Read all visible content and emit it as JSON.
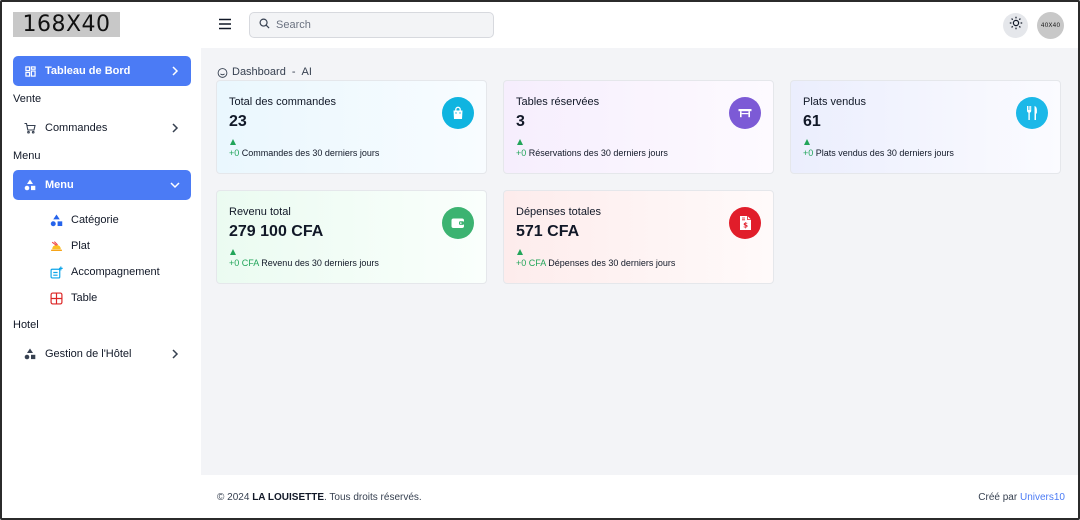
{
  "logo": {
    "text": "168X40"
  },
  "header": {
    "search_placeholder": "Search",
    "avatar_text": "40X40"
  },
  "sidebar": {
    "dashboard_label": "Tableau de Bord",
    "section_vente": "Vente",
    "commandes_label": "Commandes",
    "section_menu": "Menu",
    "menu_label": "Menu",
    "sub_items": {
      "categorie": "Catégorie",
      "plat": "Plat",
      "accompagnement": "Accompagnement",
      "table": "Table"
    },
    "section_hotel": "Hotel",
    "hotel_label": "Gestion de l'Hôtel"
  },
  "breadcrumb": {
    "home": "Dashboard",
    "separator": "-",
    "current": "AI"
  },
  "cards": {
    "commandes": {
      "title": "Total des commandes",
      "value": "23",
      "delta": "+0",
      "caption": "Commandes des 30 derniers jours",
      "icon": "shopping-bag-icon",
      "color": "#0fb4e0"
    },
    "tables": {
      "title": "Tables réservées",
      "value": "3",
      "delta": "+0",
      "caption": "Réservations des 30 derniers jours",
      "icon": "table-icon",
      "color": "#7c5ad6"
    },
    "plats": {
      "title": "Plats vendus",
      "value": "61",
      "delta": "+0",
      "caption": "Plats vendus des 30 derniers jours",
      "icon": "utensils-icon",
      "color": "#1bb8e8"
    },
    "revenu": {
      "title": "Revenu total",
      "value": "279 100 CFA",
      "delta": "+0 CFA",
      "caption": "Revenu des 30 derniers jours",
      "icon": "wallet-icon",
      "color": "#3cb371"
    },
    "depenses": {
      "title": "Dépenses totales",
      "value": "571 CFA",
      "delta": "+0 CFA",
      "caption": "Dépenses des 30 derniers jours",
      "icon": "invoice-dollar-icon",
      "color": "#e11d2a"
    }
  },
  "footer": {
    "copyright": "© 2024",
    "brand": "LA LOUISETTE",
    "rights": ". Tous droits réservés.",
    "credit_prefix": "Créé par",
    "credit_link": "Univers10"
  },
  "colors": {
    "primary": "#4b7bf5",
    "positive": "#22a55a",
    "background": "#f3f4f7"
  }
}
